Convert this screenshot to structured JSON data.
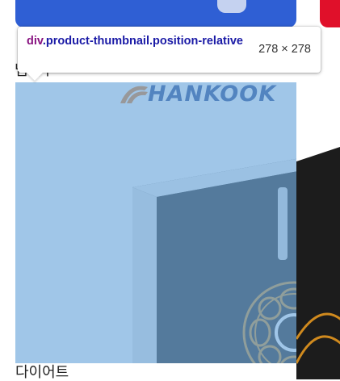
{
  "inspector_tooltip": {
    "tag": "div",
    "selector": ".product-thumbnail.position-relative",
    "dimensions": "278 × 278"
  },
  "product": {
    "brand_logo_text": "HANKOOK",
    "label_above": "냄비ㅏ",
    "label_below": "다이어트"
  },
  "colors": {
    "highlight": "#6fa8dc",
    "top_button": "#2f5fd4",
    "accent_red": "#e0102a",
    "brand_blue": "#1d3f8a"
  }
}
